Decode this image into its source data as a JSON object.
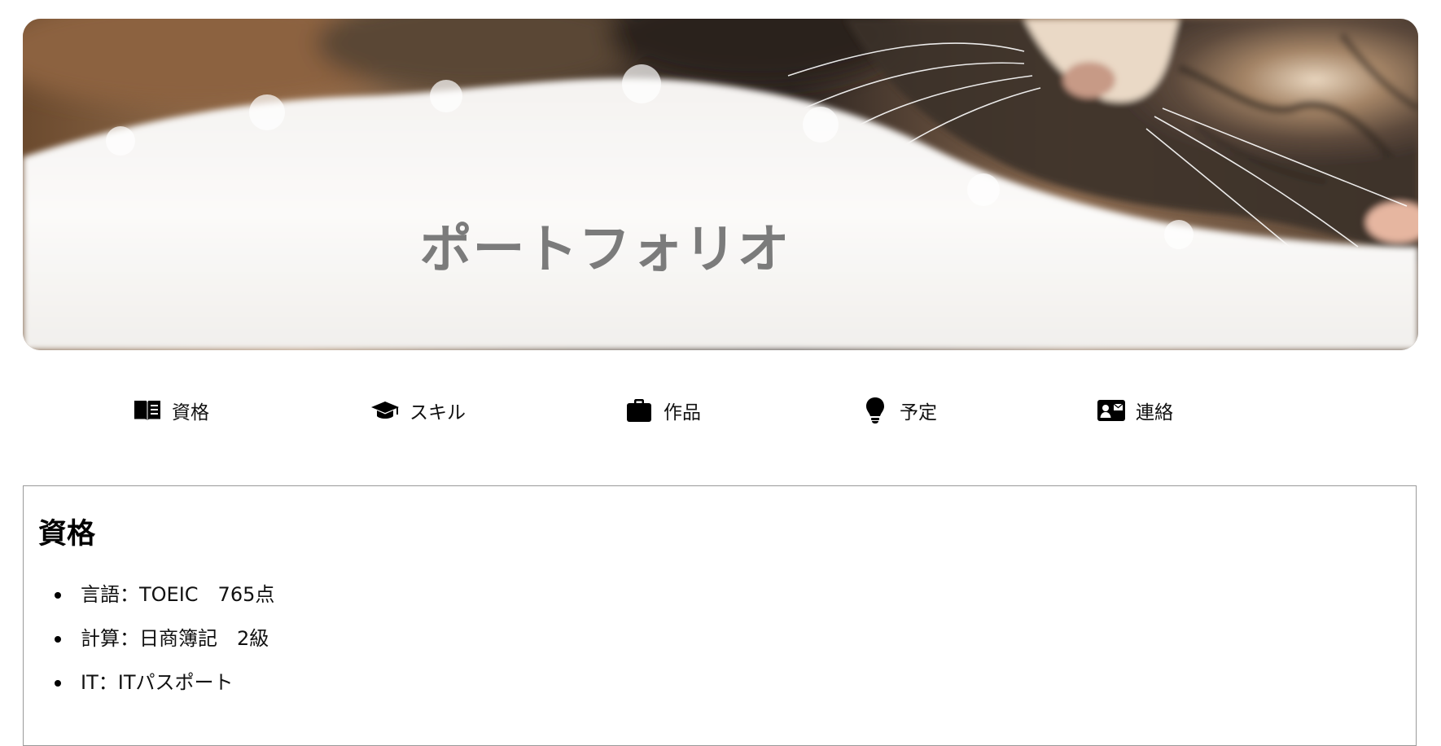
{
  "hero": {
    "title": "ポートフォリオ",
    "image": "cat-on-white-fur-photo"
  },
  "nav": {
    "items": [
      {
        "icon": "book-icon",
        "label": "資格"
      },
      {
        "icon": "graduation-cap-icon",
        "label": "スキル"
      },
      {
        "icon": "briefcase-icon",
        "label": "作品"
      },
      {
        "icon": "lightbulb-icon",
        "label": "予定"
      },
      {
        "icon": "contact-card-icon",
        "label": "連絡"
      }
    ]
  },
  "section": {
    "title": "資格",
    "items": [
      "言語：TOEIC　765点",
      "計算：日商簿記　2級",
      "IT：ITパスポート"
    ]
  },
  "colors": {
    "hero_title": "#7b7b7b",
    "section_border": "#9a9a9a",
    "text": "#111111"
  }
}
